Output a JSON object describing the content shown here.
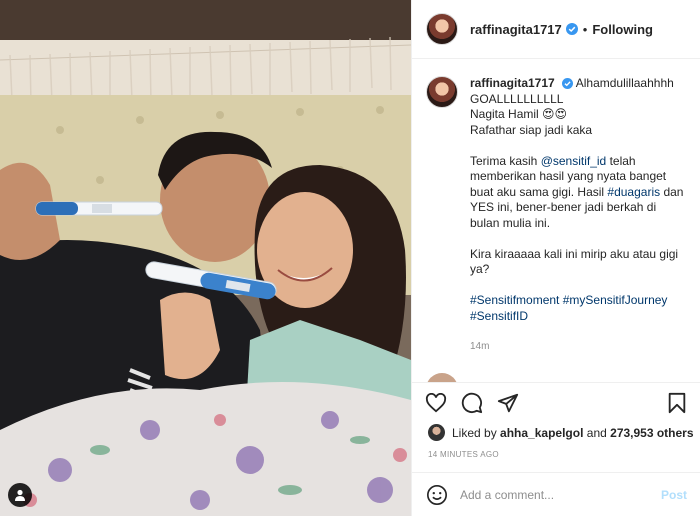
{
  "post": {
    "author": "raffinagita1717",
    "follow_state": "Following",
    "separator": "•",
    "caption_lines": [
      "Alhamdulillaahhhh",
      "GOALLLLLLLLLL",
      "Nagita Hamil 😍😍",
      "Rafathar siap jadi kaka"
    ],
    "caption_p2_a": "Terima kasih ",
    "caption_mention": "@sensitif_id",
    "caption_p2_b": " telah memberikan hasil yang nyata banget buat aku sama gigi. Hasil ",
    "caption_hashtag1": "#duagaris",
    "caption_p2_c": " dan YES ini, bener-bener jadi berkah di bulan mulia ini.",
    "caption_p3": "Kira kiraaaaa kali ini mirip aku atau gigi ya?",
    "hashtags": [
      "#Sensitifmoment",
      "#mySensitifJourney",
      "#SensitifID"
    ],
    "caption_time": "14m",
    "likes_prefix": "Liked by ",
    "liked_by_user": "ahha_kapelgol",
    "likes_mid": " and ",
    "likes_count": "273,953 others",
    "posted_ago": "14 MINUTES AGO"
  },
  "comment_box": {
    "placeholder": "Add a comment...",
    "post_label": "Post"
  },
  "icons": {
    "verified": "verified-badge-icon",
    "like": "heart-icon",
    "comment": "comment-icon",
    "share": "paper-plane-icon",
    "save": "bookmark-icon",
    "emoji": "smiley-icon",
    "user_tag": "person-icon"
  },
  "colors": {
    "verified": "#3897f0",
    "link": "#00376b",
    "post_disabled": "#b2dffc",
    "muted": "#8e8e8e"
  }
}
